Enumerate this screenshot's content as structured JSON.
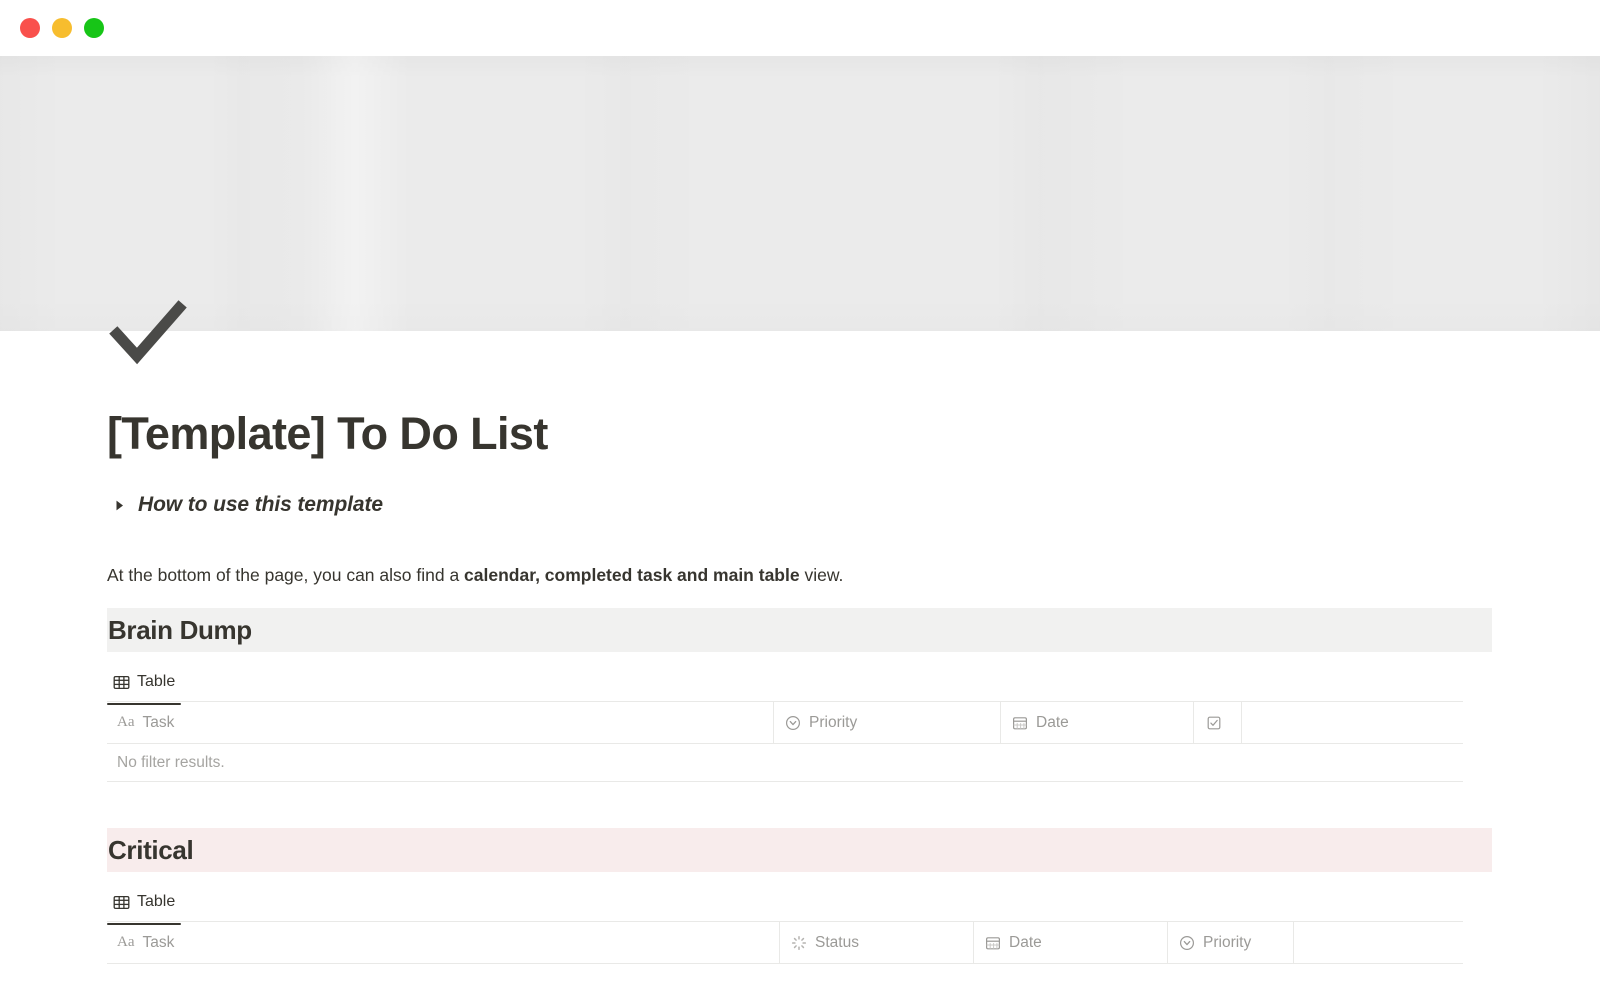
{
  "window": {
    "traffic_lights": [
      {
        "name": "close",
        "color": "#f9504c"
      },
      {
        "name": "minimize",
        "color": "#f7bd2e"
      },
      {
        "name": "maximize",
        "color": "#17c517"
      }
    ]
  },
  "page": {
    "icon": "checkmark-icon",
    "title": "[Template] To Do List",
    "cover_color": "#ebebeb"
  },
  "toggle": {
    "arrow": "triangle-right-icon",
    "label": "How to use this template",
    "expanded": false
  },
  "paragraph": {
    "lead": "At the bottom of the page, you can also find a ",
    "bold": "calendar, completed task and main table",
    "tail": " view."
  },
  "sections": [
    {
      "title": "Brain Dump",
      "band_color": "#f1f1f0",
      "tabs": [
        {
          "label": "Table",
          "icon": "table-grid-icon",
          "active": true
        }
      ],
      "columns": [
        {
          "label": "Task",
          "icon": "text-aa-icon"
        },
        {
          "label": "Priority",
          "icon": "select-chevron-circle-icon"
        },
        {
          "label": "Date",
          "icon": "calendar-icon"
        },
        {
          "label": "",
          "icon": "checkbox-icon"
        },
        {
          "label": "",
          "icon": ""
        }
      ],
      "empty_message": "No filter results.",
      "rows": []
    },
    {
      "title": "Critical",
      "band_color": "#f8ecec",
      "tabs": [
        {
          "label": "Table",
          "icon": "table-grid-icon",
          "active": true
        }
      ],
      "columns": [
        {
          "label": "Task",
          "icon": "text-aa-icon"
        },
        {
          "label": "Status",
          "icon": "status-spinner-icon"
        },
        {
          "label": "Date",
          "icon": "calendar-icon"
        },
        {
          "label": "Priority",
          "icon": "select-chevron-circle-icon"
        },
        {
          "label": "",
          "icon": ""
        }
      ],
      "empty_message": "",
      "rows": []
    }
  ]
}
